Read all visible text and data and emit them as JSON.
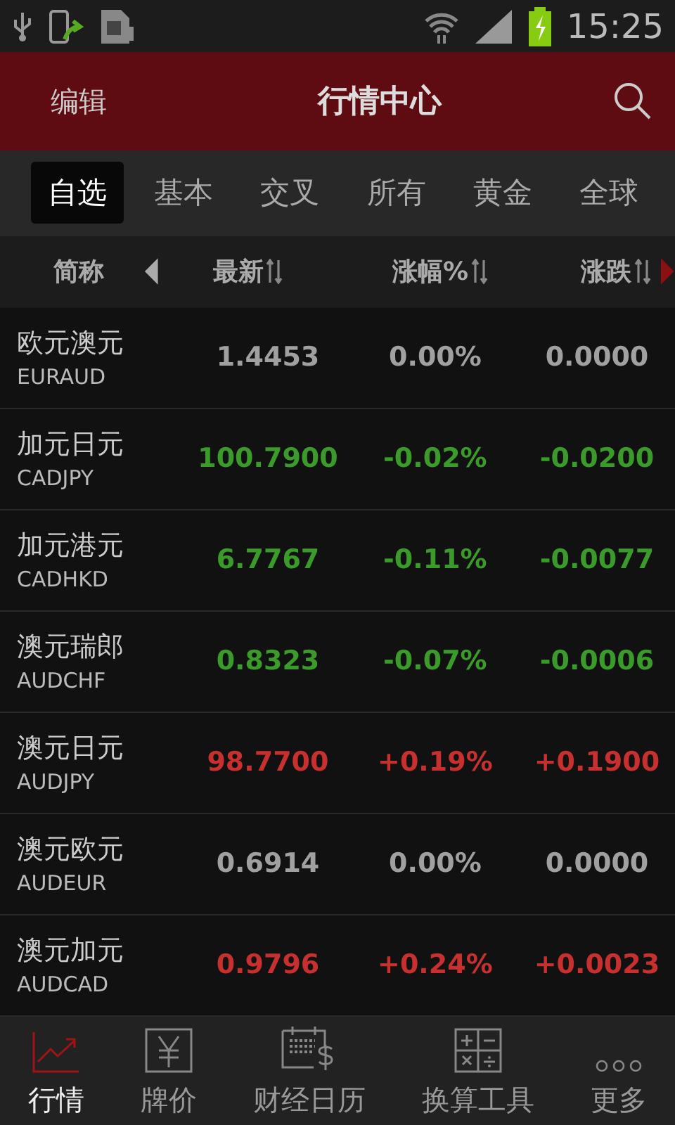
{
  "status_bar": {
    "time": "15:25"
  },
  "header": {
    "left_button": "编辑",
    "title": "行情中心"
  },
  "tabs": [
    {
      "label": "自选",
      "selected": true
    },
    {
      "label": "基本",
      "selected": false
    },
    {
      "label": "交叉",
      "selected": false
    },
    {
      "label": "所有",
      "selected": false
    },
    {
      "label": "黄金",
      "selected": false
    },
    {
      "label": "全球",
      "selected": false
    }
  ],
  "table": {
    "columns": [
      "简称",
      "最新",
      "涨幅%",
      "涨跌"
    ],
    "rows": [
      {
        "name": "欧元澳元",
        "code": "EURAUD",
        "last": "1.4453",
        "change_pct": "0.00%",
        "change": "0.0000",
        "color": "#a0a0a0"
      },
      {
        "name": "加元日元",
        "code": "CADJPY",
        "last": "100.7900",
        "change_pct": "-0.02%",
        "change": "-0.0200",
        "color": "#3a9a2a"
      },
      {
        "name": "加元港元",
        "code": "CADHKD",
        "last": "6.7767",
        "change_pct": "-0.11%",
        "change": "-0.0077",
        "color": "#3a9a2a"
      },
      {
        "name": "澳元瑞郎",
        "code": "AUDCHF",
        "last": "0.8323",
        "change_pct": "-0.07%",
        "change": "-0.0006",
        "color": "#3a9a2a"
      },
      {
        "name": "澳元日元",
        "code": "AUDJPY",
        "last": "98.7700",
        "change_pct": "+0.19%",
        "change": "+0.1900",
        "color": "#c83030"
      },
      {
        "name": "澳元欧元",
        "code": "AUDEUR",
        "last": "0.6914",
        "change_pct": "0.00%",
        "change": "0.0000",
        "color": "#a0a0a0"
      },
      {
        "name": "澳元加元",
        "code": "AUDCAD",
        "last": "0.9796",
        "change_pct": "+0.24%",
        "change": "+0.0023",
        "color": "#c83030"
      }
    ]
  },
  "bottom_nav": [
    {
      "label": "行情",
      "kind": "chart",
      "selected": true
    },
    {
      "label": "牌价",
      "kind": "yen",
      "selected": false
    },
    {
      "label": "财经日历",
      "kind": "calendar",
      "selected": false
    },
    {
      "label": "换算工具",
      "kind": "calculator",
      "selected": false
    },
    {
      "label": "更多",
      "kind": "more",
      "selected": false
    }
  ]
}
